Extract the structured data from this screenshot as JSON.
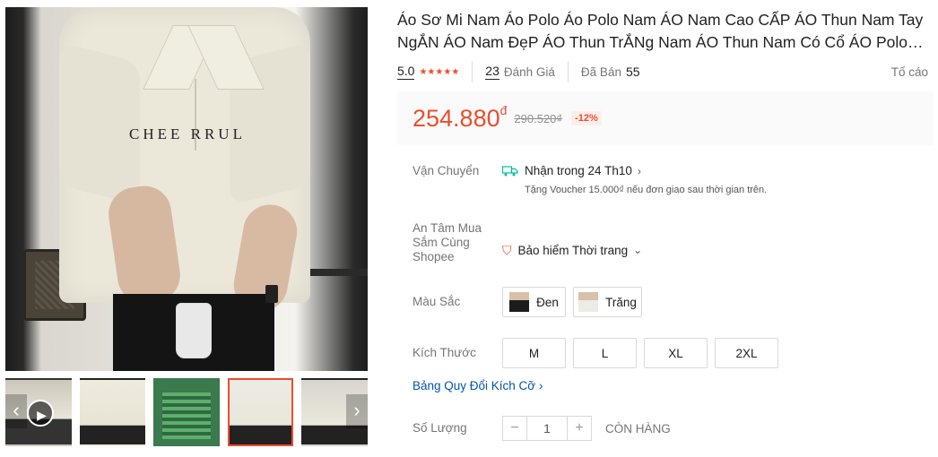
{
  "product": {
    "title": "Áo Sơ Mi Nam Áo Polo Áo Polo Nam ÁO Nam Cao CẤP ÁO Thun Nam Tay NgẮN ÁO Nam ĐẹP ÁO Thun TrẮNg Nam ÁO Thun Nam Có Cổ ÁO Polo Nam Cao Cấp Áo Thun Polo Nam",
    "shirt_print": "CHEE RRUL",
    "rating": "5.0",
    "stars": "★★★★★",
    "reviews_count": "23",
    "reviews_label": "Đánh Giá",
    "sold_label": "Đã Bán",
    "sold_count": "55",
    "report_label": "Tố cáo"
  },
  "price": {
    "current": "254.880",
    "currency": "đ",
    "original": "290.520₫",
    "discount": "-12%"
  },
  "shipping": {
    "label": "Vận Chuyển",
    "delivery": "Nhận trong 24 Th10",
    "voucher": "Tặng Voucher 15.000₫ nếu đơn giao sau thời gian trên."
  },
  "protection": {
    "label": "An Tâm Mua Sắm Cùng Shopee",
    "value": "Bảo hiểm Thời trang"
  },
  "color": {
    "label": "Màu Sắc",
    "options": [
      "Đen",
      "Trăng"
    ]
  },
  "size": {
    "label": "Kích Thước",
    "options": [
      "M",
      "L",
      "XL",
      "2XL"
    ]
  },
  "size_guide": "Bảng Quy Đổi Kích Cỡ",
  "quantity": {
    "label": "Số Lượng",
    "value": "1",
    "minus": "−",
    "plus": "+",
    "stock": "CÒN HÀNG"
  },
  "icons": {
    "truck": "truck-icon",
    "shield": "shield-icon",
    "play": "play-icon",
    "prev": "chevron-left-icon",
    "next": "chevron-right-icon"
  },
  "colors": {
    "accent": "#ee4d2d",
    "link": "#0055aa",
    "shipping_green": "#00bfa5"
  }
}
